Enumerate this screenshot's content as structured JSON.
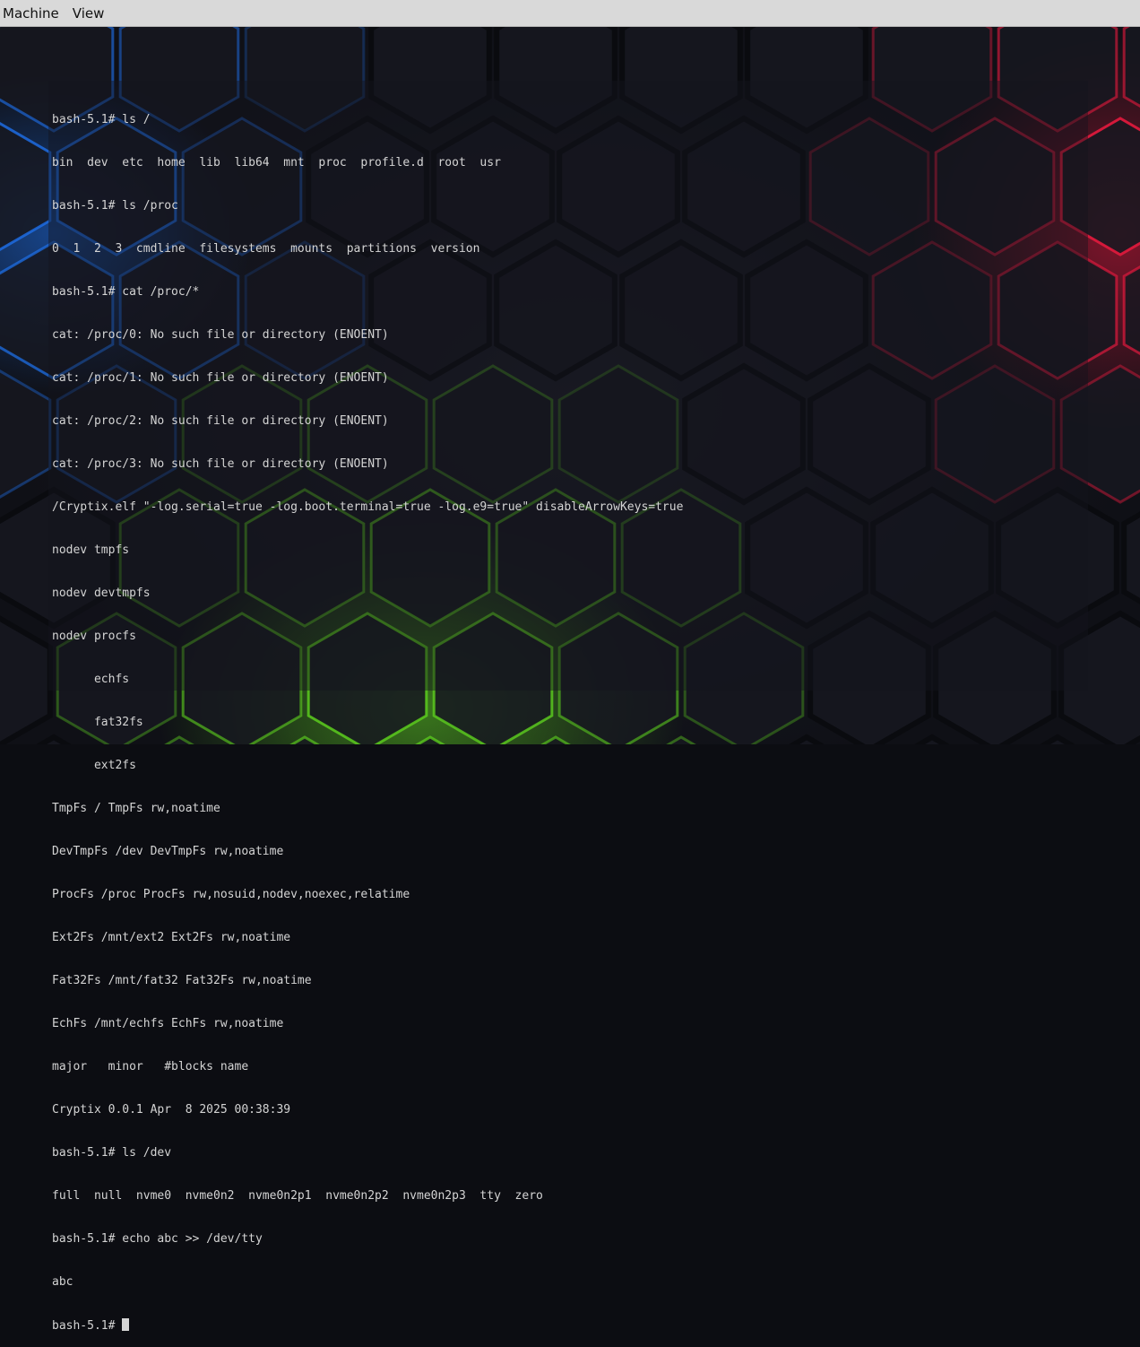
{
  "menubar": {
    "items": [
      {
        "label": "Machine"
      },
      {
        "label": "View"
      }
    ]
  },
  "colors": {
    "menubar_bg": "#d9d9d9",
    "terminal_text": "#d4d4d4",
    "glow_blue": "#1e6ee6",
    "glow_red": "#dc193c",
    "glow_green": "#5ac81e"
  },
  "terminal": {
    "lines": [
      "bash-5.1# ls /",
      "bin  dev  etc  home  lib  lib64  mnt  proc  profile.d  root  usr",
      "bash-5.1# ls /proc",
      "0  1  2  3  cmdline  filesystems  mounts  partitions  version",
      "bash-5.1# cat /proc/*",
      "cat: /proc/0: No such file or directory (ENOENT)",
      "cat: /proc/1: No such file or directory (ENOENT)",
      "cat: /proc/2: No such file or directory (ENOENT)",
      "cat: /proc/3: No such file or directory (ENOENT)",
      "/Cryptix.elf \"-log.serial=true -log.boot.terminal=true -log.e9=true\" disableArrowKeys=true",
      "nodev tmpfs",
      "nodev devtmpfs",
      "nodev procfs",
      "      echfs",
      "      fat32fs",
      "      ext2fs",
      "TmpFs / TmpFs rw,noatime",
      "DevTmpFs /dev DevTmpFs rw,noatime",
      "ProcFs /proc ProcFs rw,nosuid,nodev,noexec,relatime",
      "Ext2Fs /mnt/ext2 Ext2Fs rw,noatime",
      "Fat32Fs /mnt/fat32 Fat32Fs rw,noatime",
      "EchFs /mnt/echfs EchFs rw,noatime",
      "major   minor   #blocks name",
      "Cryptix 0.0.1 Apr  8 2025 00:38:39",
      "bash-5.1# ls /dev",
      "full  null  nvme0  nvme0n2  nvme0n2p1  nvme0n2p2  nvme0n2p3  tty  zero",
      "bash-5.1# echo abc >> /dev/tty",
      "abc"
    ],
    "prompt": "bash-5.1# "
  }
}
